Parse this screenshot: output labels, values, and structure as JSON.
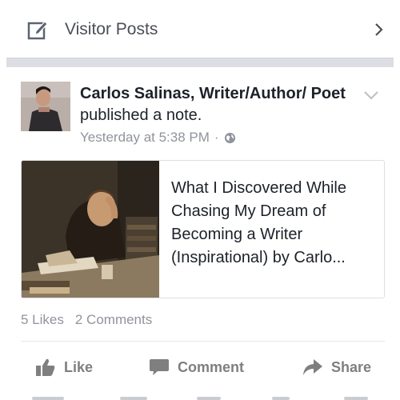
{
  "visitor_posts": {
    "label": "Visitor Posts"
  },
  "post": {
    "author": "Carlos Salinas, Writer/Author/ Poet",
    "action": "published a note.",
    "timestamp": "Yesterday at 5:38 PM",
    "separator": "·",
    "privacy_icon": "globe-icon"
  },
  "link_card": {
    "title": "What I Discovered While Chasing My Dream of Becoming a Writer (Inspirational) by Carlo..."
  },
  "counts": {
    "likes": "5 Likes",
    "comments": "2 Comments"
  },
  "actions": {
    "like": "Like",
    "comment": "Comment",
    "share": "Share"
  },
  "colors": {
    "meta_gray": "#90949c",
    "action_gray": "#7f7f7f",
    "band_gray": "#dcdee3"
  }
}
